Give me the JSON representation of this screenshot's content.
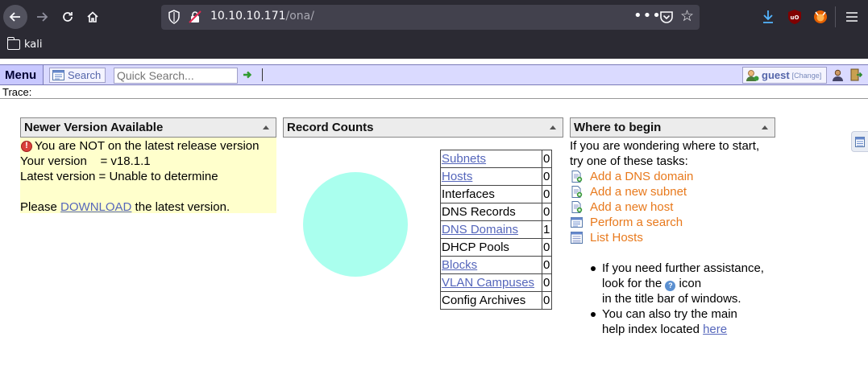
{
  "browser": {
    "url_host": "10.10.10.171",
    "url_path": "/ona/",
    "more_label": "•••",
    "bookmarks": [
      {
        "label": "kali"
      }
    ]
  },
  "menubar": {
    "menu_label": "Menu",
    "search_label": "Search",
    "quick_search_placeholder": "Quick Search...",
    "user_name": "guest",
    "user_change": "[Change]",
    "trace_label": "Trace:"
  },
  "version_panel": {
    "title": "Newer Version Available",
    "warning": "You are NOT on the latest release version",
    "your_version": "Your version    = v18.1.1",
    "latest_version": "Latest version = Unable to determine",
    "please_prefix": "Please ",
    "download_link": "DOWNLOAD",
    "please_suffix": " the latest version."
  },
  "counts_panel": {
    "title": "Record Counts",
    "chart_color": "#aaffee",
    "rows": [
      {
        "name": "Subnets",
        "value": "0",
        "link": true
      },
      {
        "name": "Hosts",
        "value": "0",
        "link": true
      },
      {
        "name": "Interfaces",
        "value": "0",
        "link": false
      },
      {
        "name": "DNS Records",
        "value": "0",
        "link": false
      },
      {
        "name": "DNS Domains",
        "value": "1",
        "link": true
      },
      {
        "name": "DHCP Pools",
        "value": "0",
        "link": false
      },
      {
        "name": "Blocks",
        "value": "0",
        "link": true
      },
      {
        "name": "VLAN Campuses",
        "value": "0",
        "link": true
      },
      {
        "name": "Config Archives",
        "value": "0",
        "link": false
      }
    ]
  },
  "begin_panel": {
    "title": "Where to begin",
    "intro_1": "If you are wondering where to start,",
    "intro_2": "try one of these tasks:",
    "tasks": [
      {
        "label": "Add a DNS domain",
        "icon": "add-page-icon"
      },
      {
        "label": "Add a new subnet",
        "icon": "add-page-icon"
      },
      {
        "label": "Add a new host",
        "icon": "add-page-icon"
      },
      {
        "label": "Perform a search",
        "icon": "search-form-icon"
      },
      {
        "label": "List Hosts",
        "icon": "list-icon"
      }
    ],
    "help_1a": "If you need further assistance,",
    "help_1b_prefix": "look for the ",
    "help_1b_suffix": " icon",
    "help_1c": "in the title bar of windows.",
    "help_2a": "You can also try the main",
    "help_2b_prefix": "help index located ",
    "help_2b_link": "here"
  },
  "colors": {
    "chrome_bg": "#2b2a33",
    "menubar_bg": "#dadaff",
    "link": "#5566bb",
    "task": "#e8791c",
    "version_bg": "#ffffcc"
  }
}
